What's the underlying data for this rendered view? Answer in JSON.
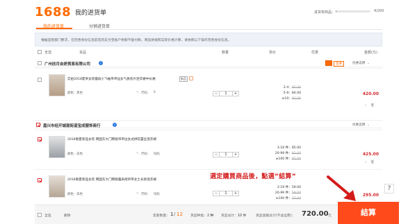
{
  "header": {
    "logo": "1688",
    "title": "我的进货单",
    "progress_label": "进货单商品：",
    "progress_count": "4/200",
    "progress_fraction": 0.02
  },
  "tabs": [
    {
      "label": "我的进货单",
      "active": true
    },
    {
      "label": "分销进货单",
      "active": false
    }
  ],
  "notice": "根据监管部门要求，在完善身份信息前您的支付宝账户余额不能付款，商品将按照实际价格计算，请依照以下操作完善身份信息。",
  "columns": {
    "select_all": "全选",
    "product": "货品",
    "quantity": "数量",
    "unit_price": "单价",
    "discount": "优惠",
    "amount": "金额(元)"
  },
  "shops": [
    {
      "name": "广州欣月会妍贸易有限公司",
      "merge_label": "合并",
      "discount_label": "优惠说明",
      "items": [
        {
          "title": "实拍2018夏季女装露肩小飞袖吊带仙女气质亮片连衣裙中长裙",
          "tag": "新品",
          "color": "颜色：黑色",
          "size_label": "尺码：",
          "size_value": "S",
          "qty_minus": "−",
          "qty": "1",
          "qty_plus": "+",
          "tiers": [
            {
              "range": "2-4：",
              "price": "85.00",
              "struck": true
            },
            {
              "range": "5-9：",
              "price": "84.00",
              "struck": false
            },
            {
              "range": "≥10：",
              "price": "83.00",
              "struck": true
            }
          ],
          "amount": "420.00"
        }
      ]
    },
    {
      "name": "嘉兴市经开城南街道宝成服饰商行",
      "discount_label": "优惠说明",
      "items": [
        {
          "title": "2018春夏新品女装 韩国东大门韩版吊带边女式拼花蕾丝连衣裙",
          "color": "颜色：白色",
          "size_label": "尺码：",
          "size_value": "均码",
          "qty_minus": "−",
          "qty": "1",
          "qty_plus": "+",
          "tiers": [
            {
              "range": "3-19 件：",
              "price": "85.00",
              "struck": false
            },
            {
              "range": "20-99 件：",
              "price": "83.00",
              "struck": true
            },
            {
              "range": "≥100 件：",
              "price": "82.00",
              "struck": true
            }
          ],
          "amount": "425.00"
        },
        {
          "title": "2018春夏新品女装 韩国东大门韩版露肩褶吊带女士长款连衣裙",
          "color": "颜色：白色",
          "size_label": "尺码：",
          "size_value": "均码",
          "qty_minus": "−",
          "qty": "1",
          "qty_plus": "+",
          "tiers": [
            {
              "range": "3-19 件：",
              "price": "59.00",
              "struck": false
            },
            {
              "range": "20-99 件：",
              "price": "58.00",
              "struck": true
            },
            {
              "range": "≥100 件：",
              "price": "57.00",
              "struck": true
            }
          ],
          "amount": "295.00"
        }
      ]
    }
  ],
  "annotation": "選定購買商品後，點選”結算”",
  "footer": {
    "select_all": "全选",
    "delete": "删除",
    "sellers_label": "卖家数量：",
    "sellers_selected": "1",
    "sellers_total": "12",
    "kinds_label": "货品种类：",
    "kinds_value": "2 种",
    "count_label": "货品总计：",
    "count_value": "10 件",
    "total_label": "货品金额总计(不含运费)：",
    "total_value": "720.00",
    "currency": "元"
  },
  "settle_button": "結算",
  "help": "?",
  "colors": {
    "accent": "#ff6a00",
    "price": "#d4282d",
    "settle": "#ff4a1c"
  }
}
